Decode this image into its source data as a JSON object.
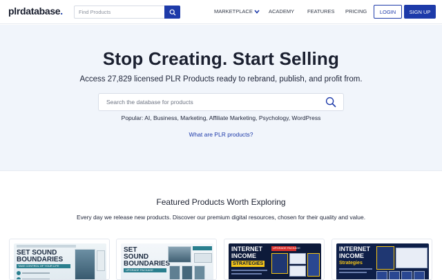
{
  "nav": {
    "logo_main": "plrdatabase",
    "logo_dot": ".",
    "search_placeholder": "Find Products",
    "links": {
      "marketplace": "MARKETPLACE",
      "academy": "ACADEMY",
      "features": "FEATURES",
      "pricing": "PRICING"
    },
    "login": "LOGIN",
    "signup": "SIGN UP"
  },
  "hero": {
    "title": "Stop Creating. Start Selling",
    "subtitle": "Access 27,829 licensed PLR Products ready to rebrand, publish, and profit from.",
    "search_placeholder": "Search the database for products",
    "popular": "Popular: AI, Business, Marketing, Affiliate Marketing, Psychology, WordPress",
    "plr_link": "What are PLR products?"
  },
  "featured": {
    "title": "Featured Products Worth Exploring",
    "description": "Every day we release new products. Discover our premium digital resources, chosen for their quality and value.",
    "cards": [
      {
        "line1": "SET SOUND",
        "line2": "BOUNDARIES",
        "tag": "TAKE CONTROL OF YOUR LIFE"
      },
      {
        "line1": "SET",
        "line2": "SOUND",
        "line3": "BOUNDARIES",
        "tag": "UPGRADE PACKAGE"
      },
      {
        "line1": "INTERNET",
        "line2": "INCOME",
        "line3": "STRATEGIES",
        "tag": "UPGRADE PACKAGE"
      },
      {
        "line1": "INTERNET",
        "line2": "INCOME",
        "line3": "Strategies"
      }
    ]
  },
  "colors": {
    "accent": "#1d3aa9",
    "hero_bg": "#f1f5fb",
    "text": "#1b2030"
  }
}
